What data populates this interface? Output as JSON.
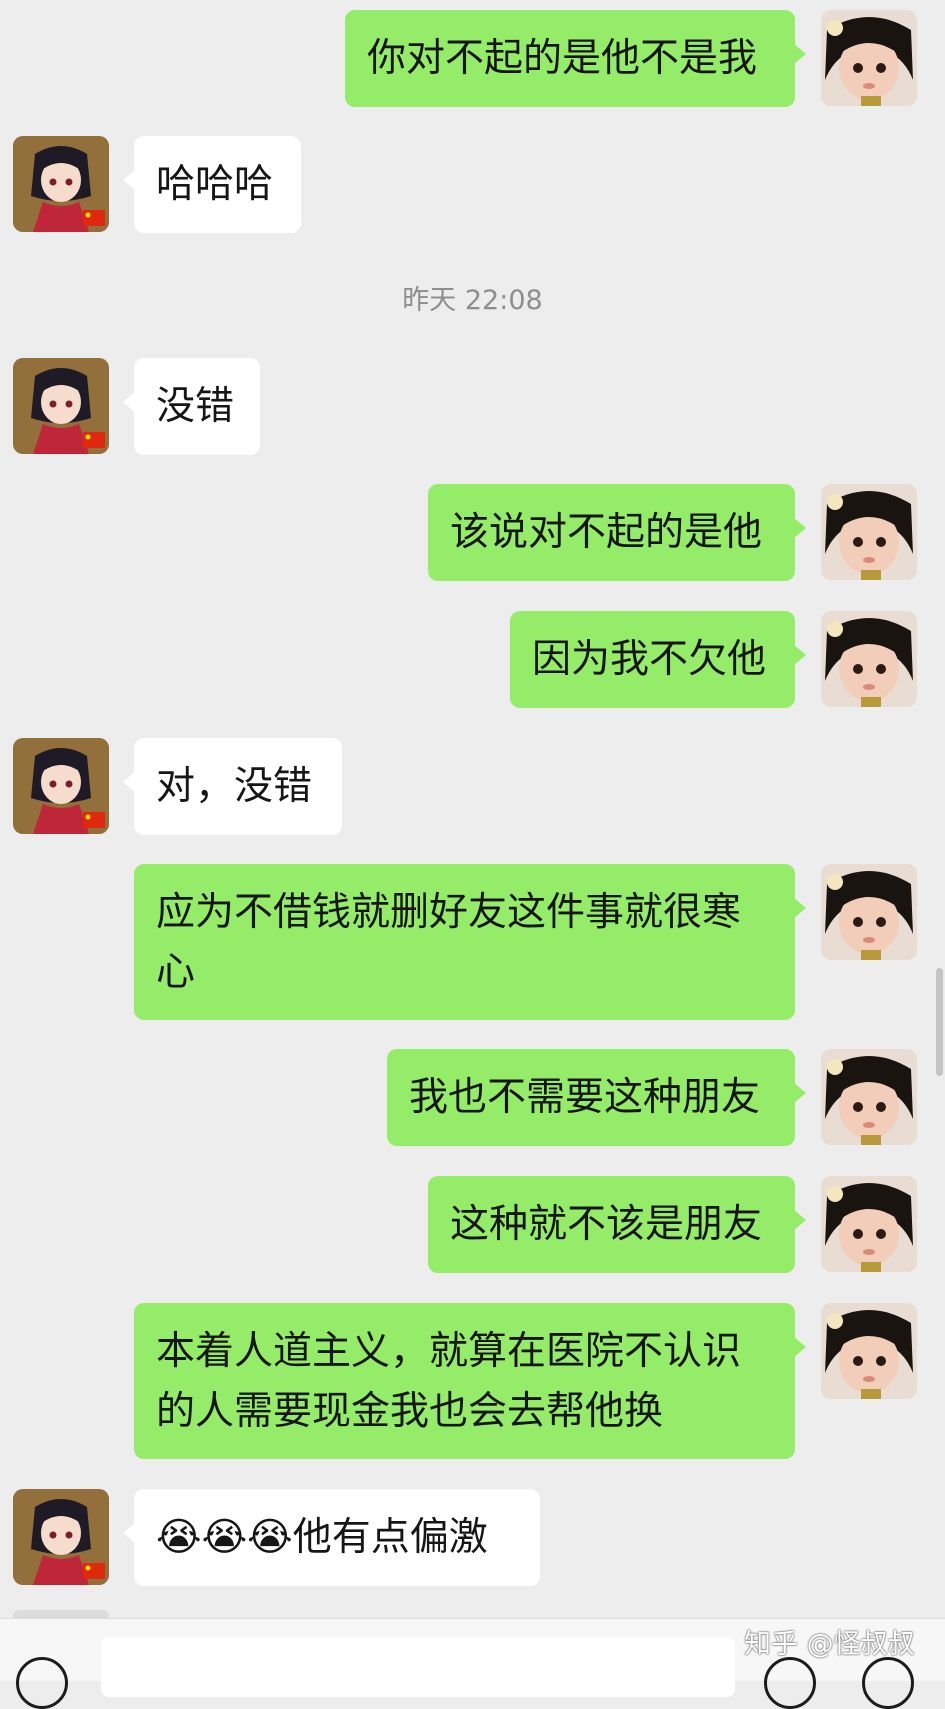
{
  "timestamp": "昨天 22:08",
  "messages": [
    {
      "side": "right",
      "text": "你对不起的是他不是我"
    },
    {
      "side": "left",
      "text": "哈哈哈"
    },
    {
      "side": "left",
      "text": "没错"
    },
    {
      "side": "right",
      "text": "该说对不起的是他"
    },
    {
      "side": "right",
      "text": "因为我不欠他"
    },
    {
      "side": "left",
      "text": "对，没错"
    },
    {
      "side": "right",
      "text": "应为不借钱就删好友这件事就很寒\n心"
    },
    {
      "side": "right",
      "text": "我也不需要这种朋友"
    },
    {
      "side": "right",
      "text": "这种就不该是朋友"
    },
    {
      "side": "right",
      "text": "本着人道主义，就算在医院不认识\n的人需要现金我也会去帮他换"
    },
    {
      "side": "left",
      "text": "😭😭😭他有点偏激"
    }
  ],
  "bottom_bar": {
    "voice_icon": "voice-icon",
    "emoji_icon": "emoji-icon",
    "plus_icon": "plus-icon"
  },
  "watermark": "知乎 @怪叔叔",
  "colors": {
    "background": "#ededed",
    "sent_bubble": "#95ec69",
    "received_bubble": "#ffffff"
  }
}
